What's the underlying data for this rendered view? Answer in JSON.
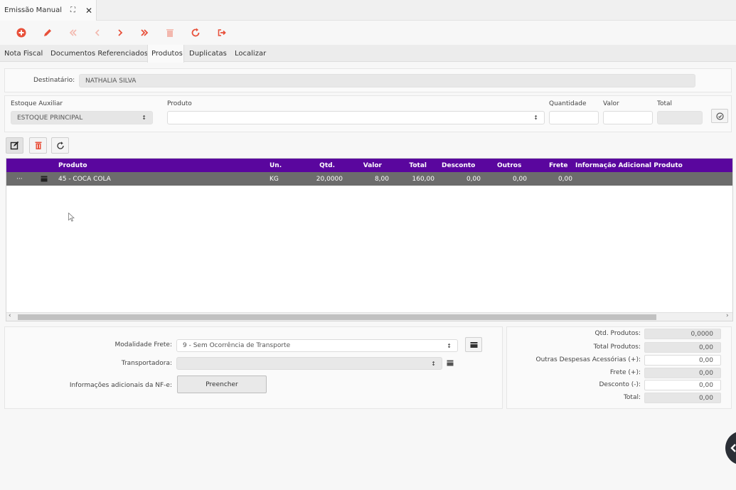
{
  "doc_tab": {
    "label": "Emissão Manual"
  },
  "section_tabs": [
    "Nota Fiscal",
    "Documentos Referenciados",
    "Produtos",
    "Duplicatas",
    "Localizar"
  ],
  "recipient": {
    "label": "Destinatário:",
    "value": "NATHALIA SILVA"
  },
  "product_form": {
    "stock_label": "Estoque Auxiliar",
    "stock_value": "ESTOQUE PRINCIPAL",
    "product_label": "Produto",
    "product_value": "",
    "quantity_label": "Quantidade",
    "quantity_value": "",
    "price_label": "Valor",
    "price_value": "",
    "total_label": "Total",
    "total_value": ""
  },
  "grid": {
    "columns": [
      "Produto",
      "Un.",
      "Qtd.",
      "Valor",
      "Total",
      "Desconto",
      "Outros",
      "Frete",
      "Informação Adicional Produto"
    ],
    "rows": [
      {
        "menu": "···",
        "product": "45 - COCA COLA",
        "unit": "KG",
        "qty": "20,0000",
        "price": "8,00",
        "total": "160,00",
        "discount": "0,00",
        "others": "0,00",
        "freight": "0,00",
        "info": ""
      }
    ]
  },
  "transport": {
    "freight_mode_label": "Modalidade Frete:",
    "freight_mode_value": "9 - Sem Ocorrência de Transporte",
    "carrier_label": "Transportadora:",
    "carrier_value": "",
    "info_label": "Informações adicionais da NF-e:",
    "fill_button": "Preencher"
  },
  "totals": [
    {
      "label": "Qtd. Produtos:",
      "value": "0,0000",
      "editable": false
    },
    {
      "label": "Total Produtos:",
      "value": "0,00",
      "editable": false
    },
    {
      "label": "Outras Despesas Acessórias (+):",
      "value": "0,00",
      "editable": true
    },
    {
      "label": "Frete (+):",
      "value": "0,00",
      "editable": false
    },
    {
      "label": "Desconto (-):",
      "value": "0,00",
      "editable": true
    },
    {
      "label": "Total:",
      "value": "0,00",
      "editable": false
    }
  ],
  "colors": {
    "accent": "#e8503a",
    "grid_header": "#5a069e",
    "selected_row": "#6c6c6c"
  },
  "icons": [
    "plus-circle-icon",
    "pencil-icon",
    "first-icon",
    "previous-icon",
    "next-icon",
    "last-icon",
    "trash-icon",
    "refresh-icon",
    "exit-icon"
  ]
}
